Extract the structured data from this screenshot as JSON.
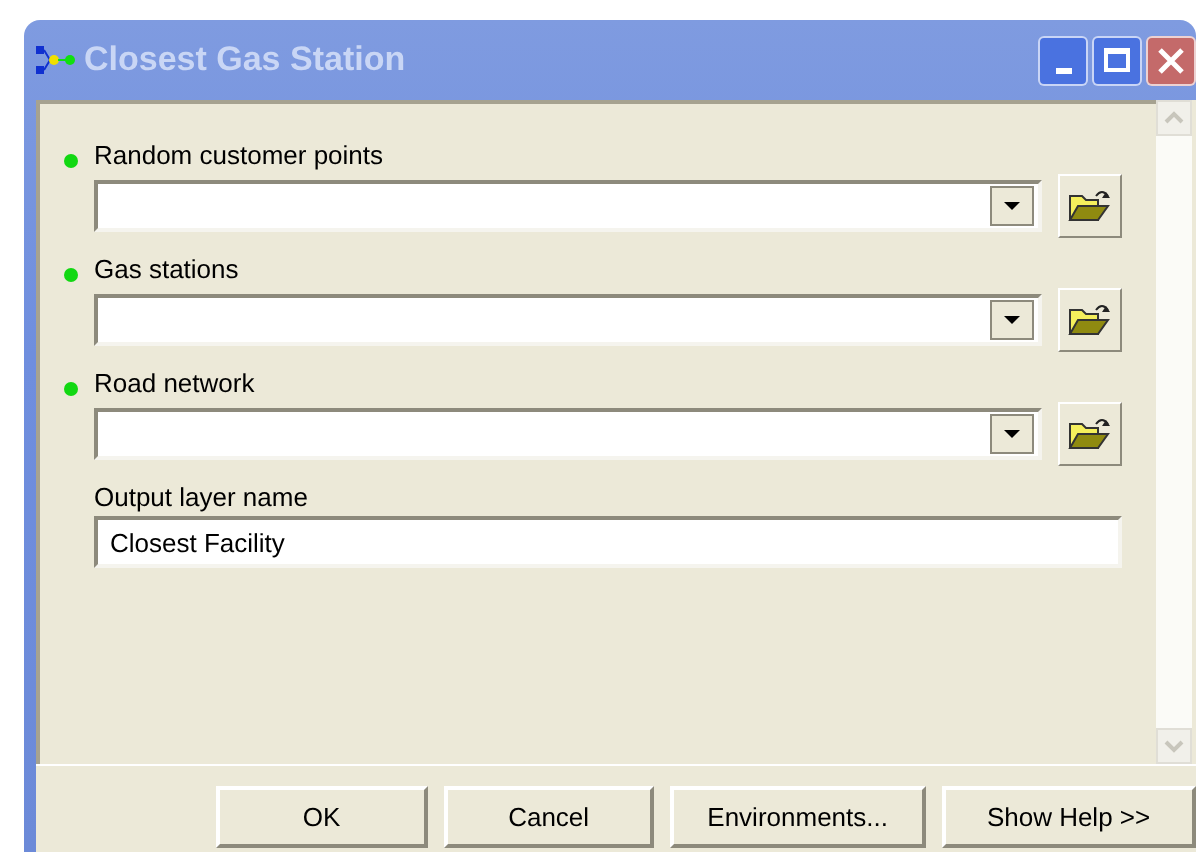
{
  "window": {
    "title": "Closest Gas Station"
  },
  "parameters": [
    {
      "label": "Random customer points",
      "kind": "combo",
      "required": true
    },
    {
      "label": "Gas stations",
      "kind": "combo",
      "required": true
    },
    {
      "label": "Road network",
      "kind": "combo",
      "required": true
    },
    {
      "label": "Output layer name",
      "kind": "text",
      "required": false,
      "value": "Closest Facility"
    }
  ],
  "buttons": [
    "OK",
    "Cancel",
    "Environments...",
    "Show Help >>"
  ]
}
